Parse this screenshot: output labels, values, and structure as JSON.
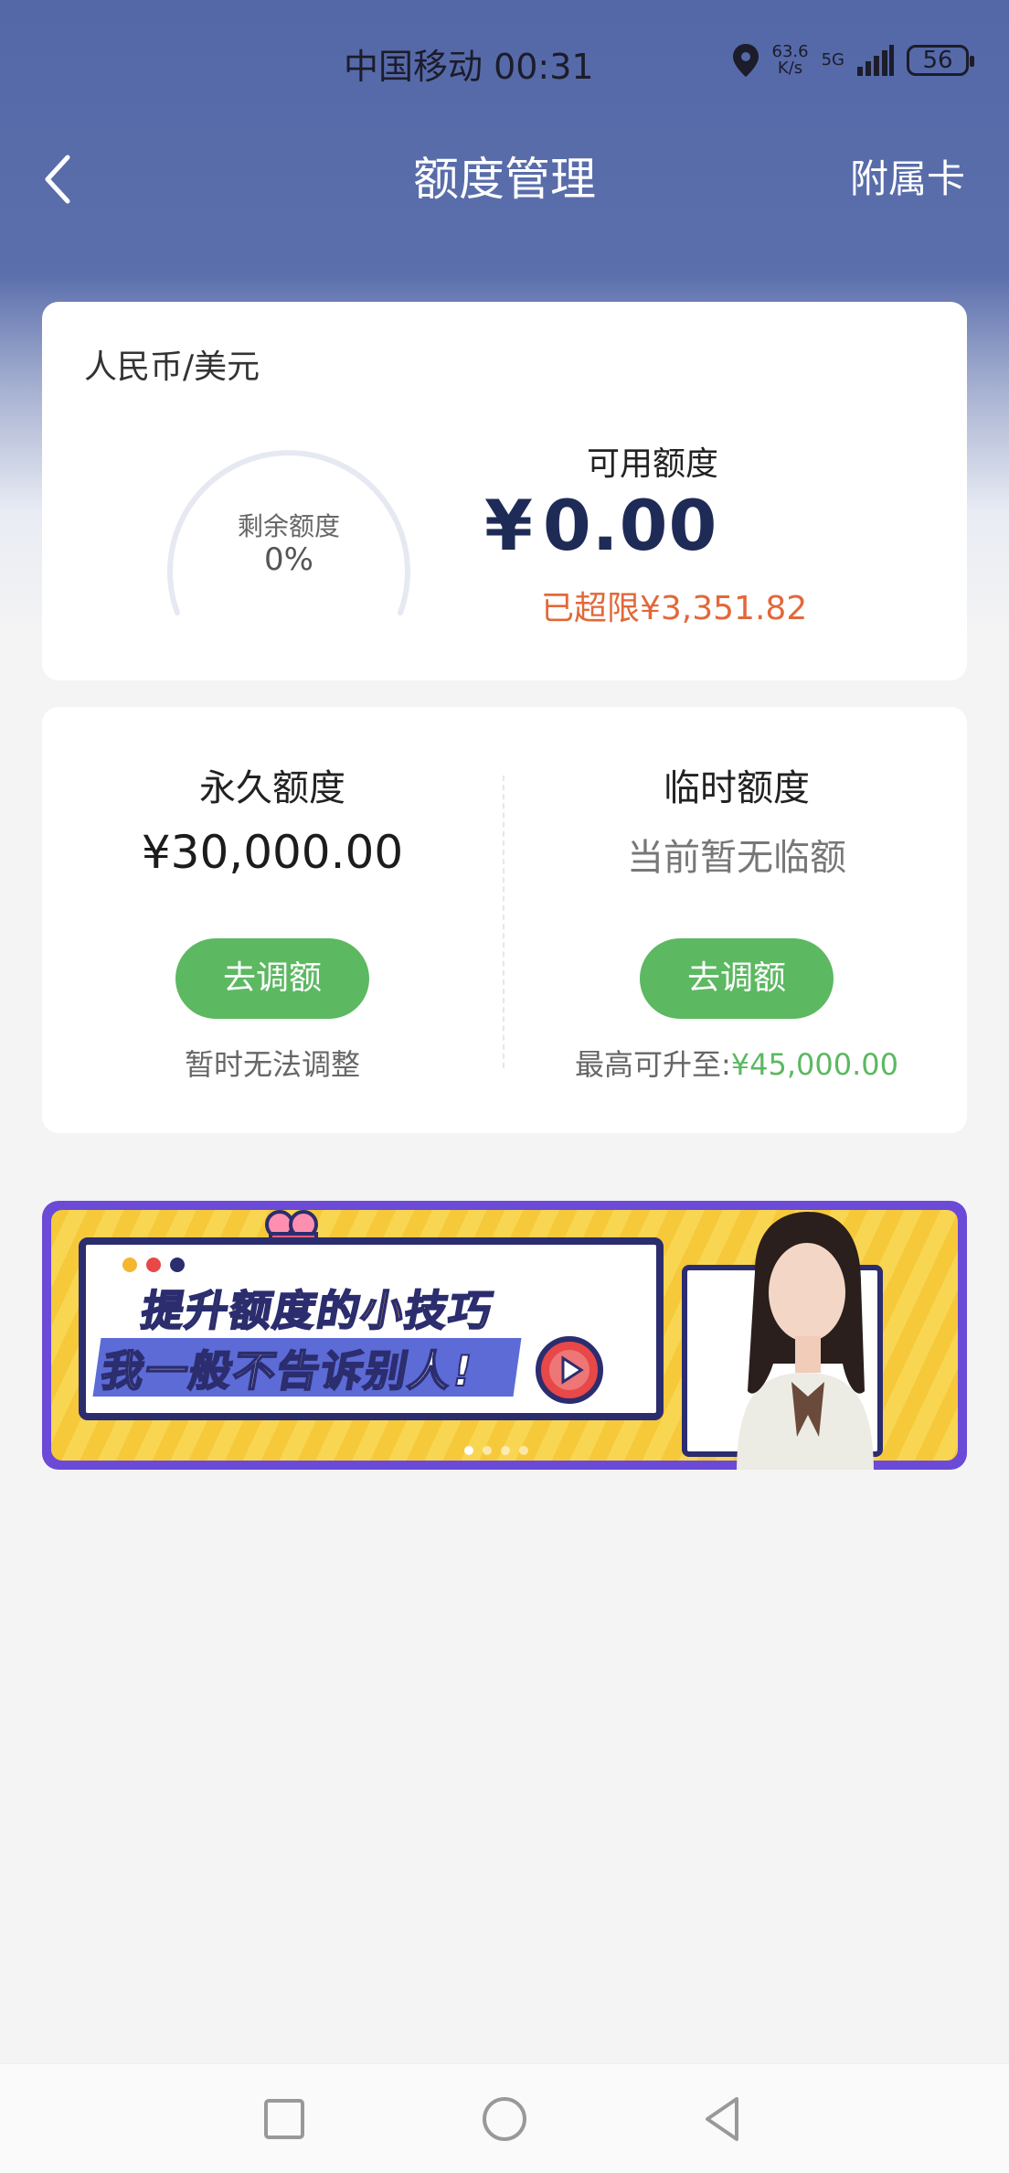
{
  "status_bar": {
    "carrier_time": "中国移动 00:31",
    "net_speed_value": "63.6",
    "net_speed_unit": "K/s",
    "network": "5G",
    "battery": "56",
    "icons": [
      "location-icon",
      "signal-icon",
      "battery-icon"
    ]
  },
  "nav": {
    "title": "额度管理",
    "action": "附属卡"
  },
  "summary_card": {
    "currency": "人民币/美元",
    "gauge_label": "剩余额度",
    "gauge_value": "0%",
    "gauge_fraction": 0,
    "available_label": "可用额度",
    "available_currency": "¥",
    "available_amount": "0.00",
    "over_limit": "已超限¥3,351.82"
  },
  "limits_card": {
    "permanent": {
      "title": "永久额度",
      "amount": "¥30,000.00",
      "button": "去调额",
      "note": "暂时无法调整"
    },
    "temporary": {
      "title": "临时额度",
      "status": "当前暂无临额",
      "button": "去调额",
      "note_label": "最高可升至:",
      "note_amount": "¥45,000.00"
    }
  },
  "banner": {
    "line1": "提升额度的小技巧",
    "line2": "我一般不告诉别人!",
    "slide_count": 4,
    "active_slide": 1
  },
  "colors": {
    "header": "#5468a8",
    "accent_green": "#5cb861",
    "warning_orange": "#e2683a",
    "amount_navy": "#1f2b57"
  }
}
